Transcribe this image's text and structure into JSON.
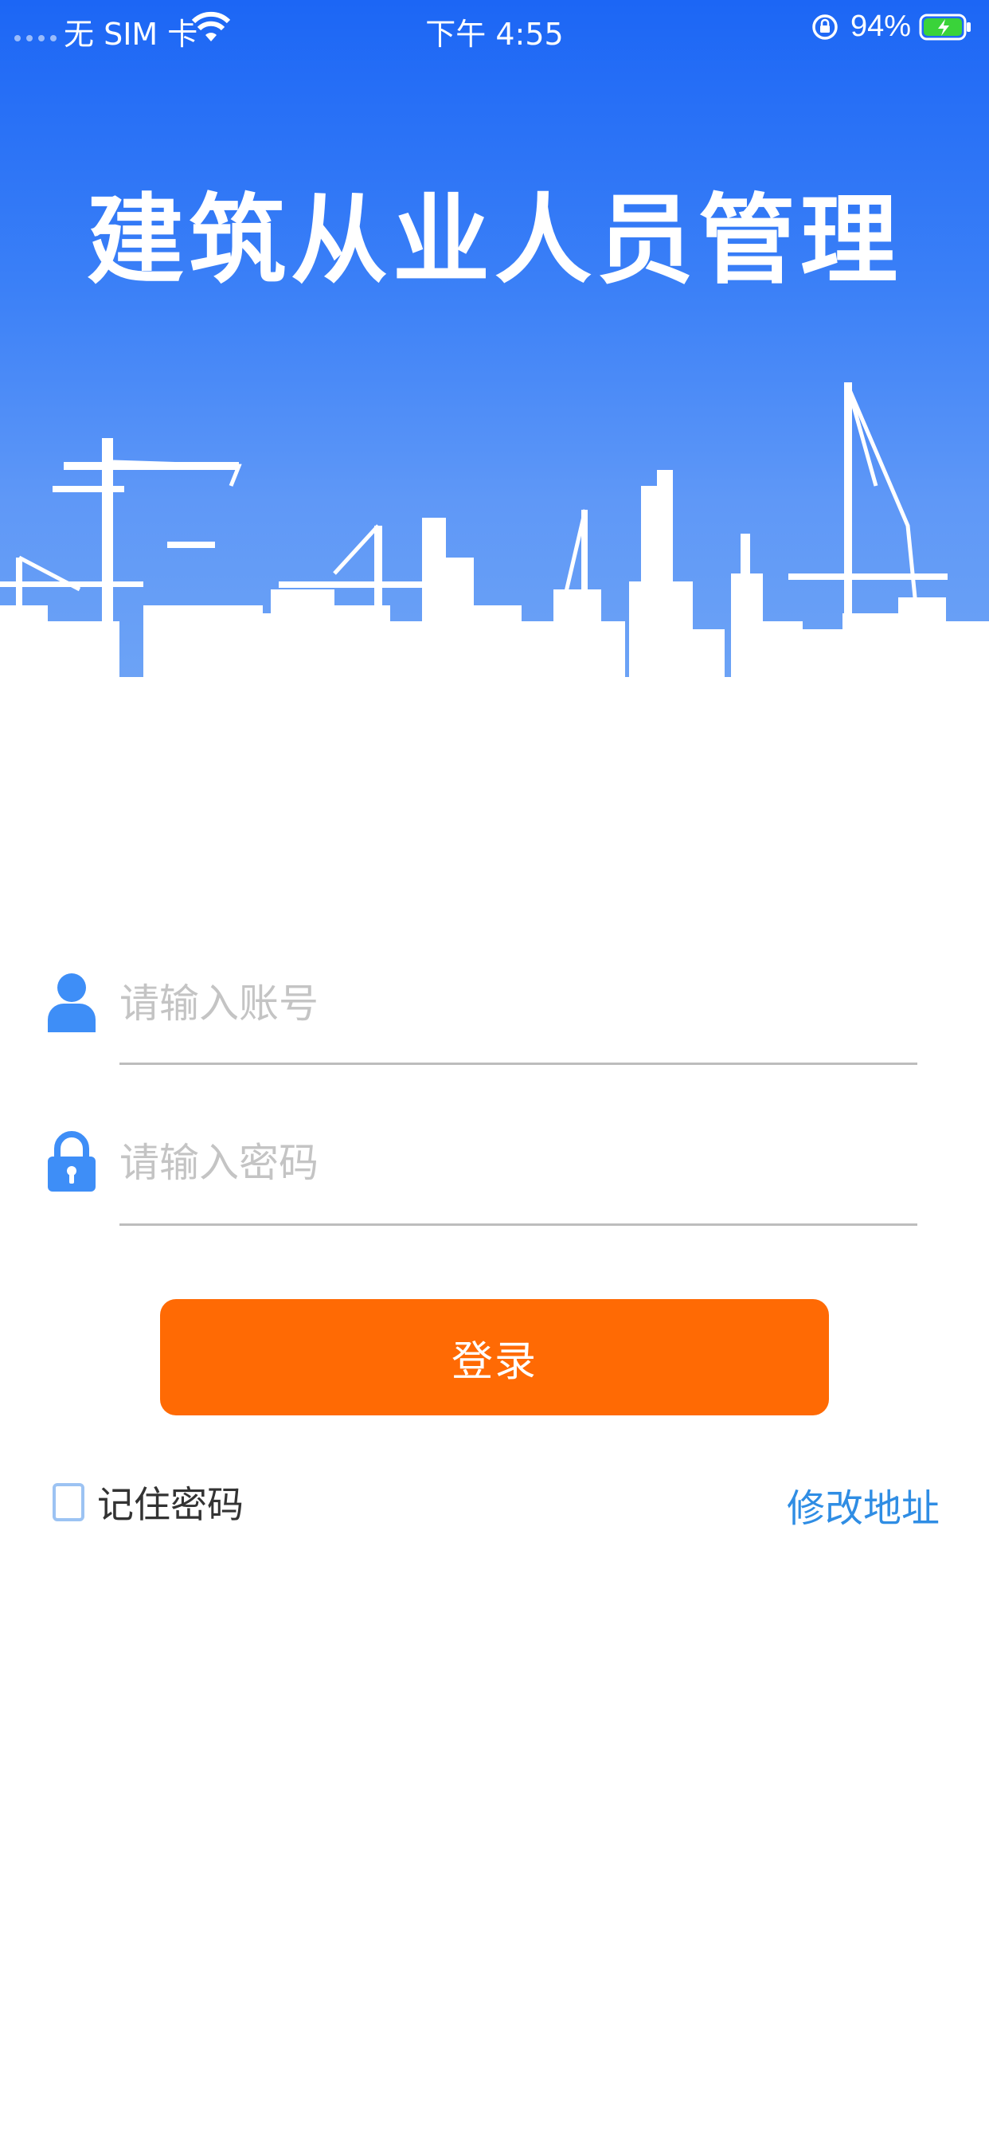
{
  "status_bar": {
    "carrier": "无 SIM 卡",
    "time": "下午 4:55",
    "battery_percent": "94%"
  },
  "header": {
    "title": "建筑从业人员管理"
  },
  "form": {
    "account_placeholder": "请输入账号",
    "password_placeholder": "请输入密码",
    "login_label": "登录",
    "remember_label": "记住密码",
    "remember_checked": false,
    "change_address_label": "修改地址"
  },
  "colors": {
    "header_blue": "#1c66f5",
    "login_orange": "#ff6a04",
    "icon_blue": "#3e8ef7",
    "link_blue": "#2f8de4"
  },
  "icons": [
    "signal-dots-icon",
    "wifi-icon",
    "rotation-lock-icon",
    "battery-charging-icon",
    "user-icon",
    "lock-icon"
  ]
}
